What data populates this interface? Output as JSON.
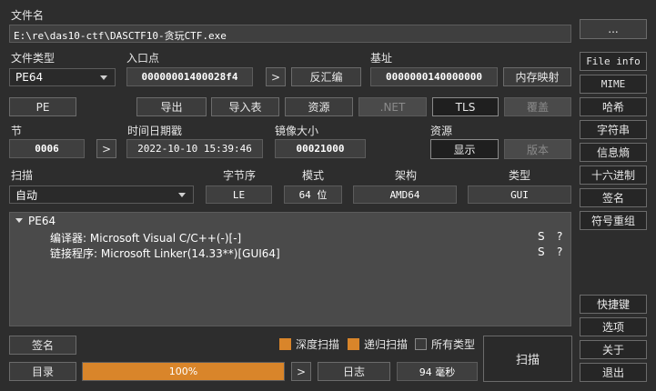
{
  "file": {
    "label": "文件名",
    "path": "E:\\re\\das10-ctf\\DASCTF10-贪玩CTF.exe",
    "browse": "..."
  },
  "filetype": {
    "label": "文件类型",
    "value": "PE64"
  },
  "entry": {
    "label": "入口点",
    "value": "00000001400028f4",
    "go": ">",
    "disasm": "反汇编"
  },
  "base": {
    "label": "基址",
    "value": "0000000140000000",
    "memmap": "内存映射"
  },
  "toolbar": {
    "pe": "PE",
    "export": "导出",
    "import": "导入表",
    "resource": "资源",
    "net": ".NET",
    "tls": "TLS",
    "overlay": "覆盖"
  },
  "section": {
    "label": "节",
    "value": "0006",
    "go": ">"
  },
  "datetime": {
    "label": "时间日期戳",
    "value": "2022-10-10 15:39:46"
  },
  "imagesize": {
    "label": "镜像大小",
    "value": "00021000"
  },
  "resources": {
    "label": "资源",
    "show": "显示",
    "version": "版本"
  },
  "scan": {
    "label": "扫描",
    "mode_value": "自动"
  },
  "endian": {
    "label": "字节序",
    "value": "LE"
  },
  "mode": {
    "label": "模式",
    "value": "64 位"
  },
  "arch": {
    "label": "架构",
    "value": "AMD64"
  },
  "type": {
    "label": "类型",
    "value": "GUI"
  },
  "results": {
    "root": "PE64",
    "items": [
      {
        "text": "编译器: Microsoft Visual C/C++(-)[-]",
        "s": "S",
        "q": "?"
      },
      {
        "text": "链接程序: Microsoft Linker(14.33**)[GUI64]",
        "s": "S",
        "q": "?"
      }
    ]
  },
  "bottom": {
    "signature": "签名",
    "directory": "目录",
    "progress_text": "100%",
    "progress": 1.0,
    "next": ">",
    "log": "日志",
    "time": "94 毫秒",
    "deep": "深度扫描",
    "recursive": "递归扫描",
    "alltypes": "所有类型",
    "scan": "扫描"
  },
  "sidebar": {
    "fileinfo": "File info",
    "mime": "MIME",
    "hash": "哈希",
    "strings": "字符串",
    "entropy": "信息熵",
    "hex": "十六进制",
    "signature": "签名",
    "demangle": "符号重组",
    "shortcuts": "快捷键",
    "options": "选项",
    "about": "关于",
    "exit": "退出"
  },
  "colors": {
    "accent": "#d9852a",
    "bg": "#2d2d2d"
  }
}
